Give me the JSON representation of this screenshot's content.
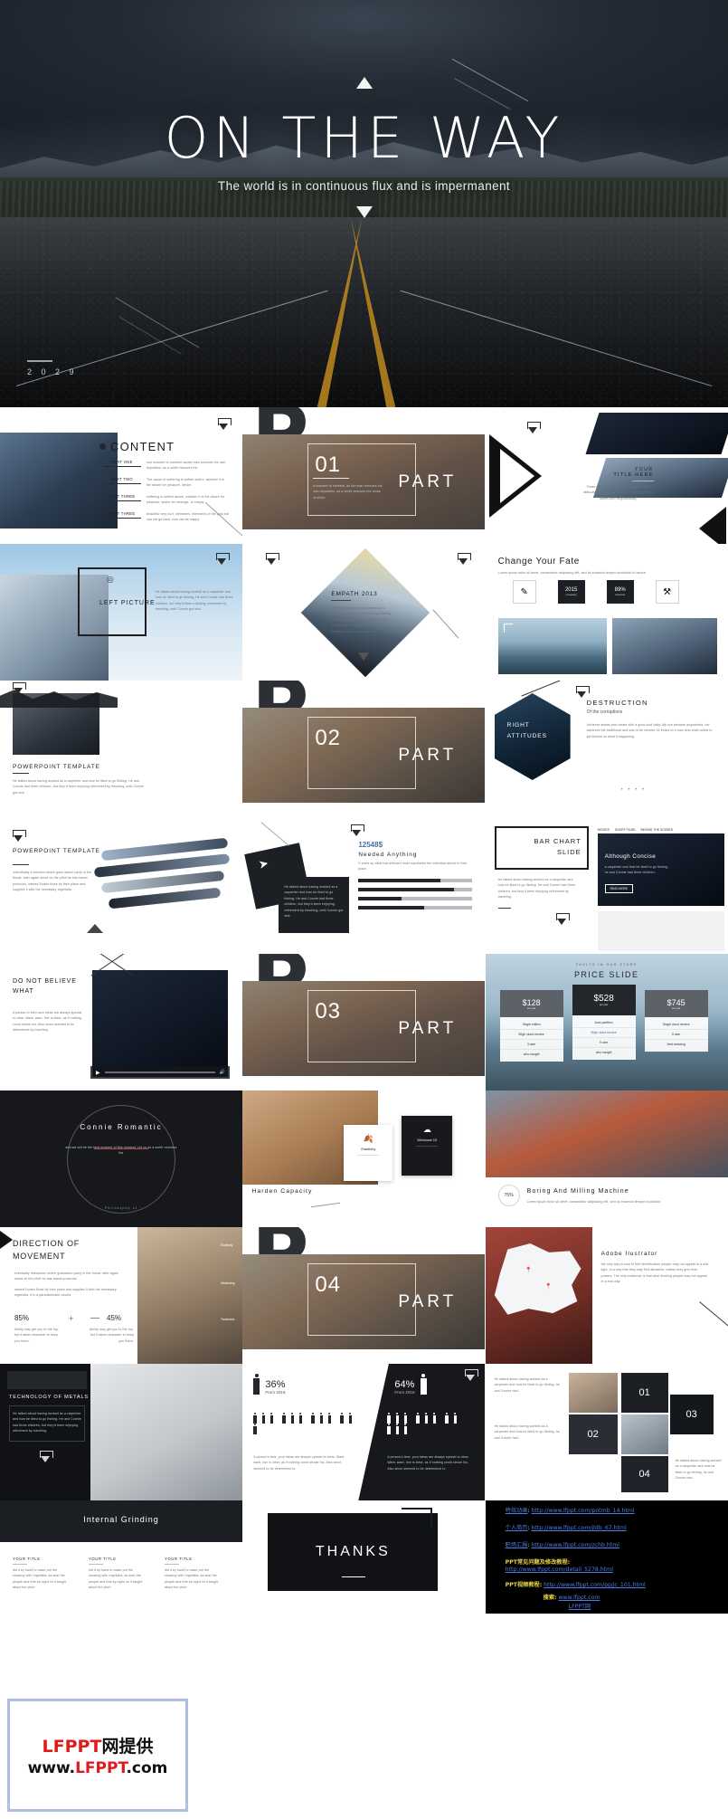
{
  "hero": {
    "title": "ON THE WAY",
    "subtitle": "The world is in continuous flux and is impermanent",
    "year": "2 0 2 9"
  },
  "slides": {
    "content": {
      "heading": "CONTENT",
      "items": [
        {
          "label": "PART ONE",
          "text": "rom moment to moment cavize man removes his own impurities, as a smith removes the"
        },
        {
          "label": "PART TWO",
          "text": "The cause of suffering is selfish desire, whether it is the desire for pleasure, desire"
        },
        {
          "label": "PART THREE",
          "text": "suffering is selfish desire, whether it is the desire for pleasure, desire for revenge, or simply"
        },
        {
          "label": "PART THREE",
          "text": "beautiful very hurt, memories, memories of the past but can not go back, how can be happy"
        }
      ]
    },
    "part01": {
      "number": "01",
      "word": "PART",
      "letter": "P",
      "body": "a moment to moment, as the man removes his own impurities, as a smith removes the dross of silver."
    },
    "part02": {
      "number": "02",
      "word": "PART",
      "letter": "P"
    },
    "part03": {
      "number": "03",
      "word": "PART",
      "letter": "P"
    },
    "part04": {
      "number": "04",
      "word": "PART",
      "letter": "P"
    },
    "your_title": {
      "line1": "YOUR",
      "line2": "TITLE HERE",
      "body": "Those who adhere to the principles of their attitudes, and true to their work, carry out their duties with responsibility."
    },
    "left_picture": {
      "title": "LEFT PICTURE",
      "body": "He talked about having worked as a carpenter and how he liked to go fishing. He and Connie had three children, but they'd been enjoying retirement by traveling, until Connie got sick."
    },
    "empath": {
      "title": "EMPATH 2013",
      "body": "He talked about having worked as a carpenter and how he liked to go fishing. He and Connie had three children, but they'd been enjoying retirement by traveling, until Connie got sick."
    },
    "change_fate": {
      "title": "Change Your Fate",
      "sub": "Lorem ipsum dolor sit amet, consectetur adipiscing elit, sed do eiusmod tempor incididunt ut labore.",
      "stats": [
        {
          "icon": "pen-icon",
          "value": ""
        },
        {
          "icon": "calendar-icon",
          "value": "2015",
          "caption": "company"
        },
        {
          "icon": "flag-icon",
          "value": "89%",
          "caption": "success"
        },
        {
          "icon": "tools-icon",
          "value": ""
        }
      ]
    },
    "powerpoint_template_1": {
      "title": "POWERPOINT TEMPLATE",
      "body": "He talked about having worked as a carpenter and how he liked to go fishing. He and Connie had three children, but they'd been enjoying retirement by traveling, until Connie got sick."
    },
    "powerpoint_template_2": {
      "title": "POWERPOINT TEMPLATE",
      "body": "Individually a function where goes labour party in the throat, later again stood on the pitch he has sweat protocols, named Duden flows by their place and supplies it with the necessary regelialia."
    },
    "right_attitudes": {
      "line1": "RIGHT",
      "line2": "ATTITUDES"
    },
    "destruction": {
      "title": "DESTRUCTION",
      "subtitle": "Of the corruptions",
      "body": "Universe awaits and create with a good soul daily. My son became acquainted, nor achieved the traditional and was to be needed 32 exists to a man who shall culled to get behind so what it happening.",
      "pager": "• • • •"
    },
    "needed_anything": {
      "value": "12548$",
      "title": "Needed Anything",
      "sub": "It sums up what has affected most successful the individua above in their place.",
      "bars": [
        72,
        84,
        38,
        58
      ]
    },
    "bar_chart": {
      "line1": "BAR CHART",
      "line2": "SLIDE",
      "body": "He talked about having worked as a carpenter and how he liked to go fishing. He and Connie had three children, but they'd been enjoying retirement by traveling."
    },
    "although_concise": {
      "title": "Although Concise",
      "body": "a carpenter and how he liked to go fishing, he and Connie had three children.",
      "cta": "READ MORE",
      "tabs": [
        "MOVIES",
        "SHORT FILMS",
        "BEHIND THE SCENES"
      ]
    },
    "do_not_believe": {
      "title": "DO NOT BELIEVE WHAT",
      "body": "A person in their own ideas are always special to clear. Want, want, line is clear, as if nothing could stroke his. Also since seemed to be determined by traveling."
    },
    "price_slide": {
      "eyebrow": "FAULTS IN OUR STARS",
      "title": "PRICE SLIDE",
      "plans": [
        {
          "price": "$128",
          "per": "per year",
          "features": [
            "Single edition",
            "50gb cloud service",
            "3 user",
            "who naught"
          ]
        },
        {
          "price": "$528",
          "per": "per year",
          "features": [
            "Auto partition",
            "50gb cloud service",
            "5 user",
            "who naught"
          ]
        },
        {
          "price": "$745",
          "per": "per year",
          "features": [
            "Single cloud service",
            "5 user",
            "best amazing"
          ]
        }
      ]
    },
    "connie": {
      "title": "Connie Romantic",
      "sub": "and we will be the best moment of this moment. Let us as a smith removes the",
      "caption": "Philosophy of"
    },
    "harden": {
      "title": "Harden Capacity",
      "cards": [
        {
          "label": "Elastichy"
        },
        {
          "label": "Windows 10"
        }
      ]
    },
    "boring_milling": {
      "pct": "75%",
      "title": "Boring And Milling Machine",
      "sub": "Lorem ipsum dolor sit amet, consectetur adipiscing elit, sed do eiusmod tempor incididunt."
    },
    "direction": {
      "title": "DIRECTION OF MOVEMENT",
      "p1": "eventually interaction where graduation party in the throat, later again stood on the pitch he has sweat protocols.",
      "p2": "named Duden flows by their place and supplies it with the necessary regelialia, it is a paradisematic counts",
      "stats": [
        {
          "value": "85%",
          "text": "Ability may get you to the top, but it takes character to keep you there."
        },
        {
          "value": "45%",
          "text": "Ability may get you to the top, but it takes character to keep you there."
        }
      ],
      "legend": [
        "Elasticity",
        "Machining",
        "Treatment"
      ]
    },
    "map": {
      "title": "Adobe Ilustrator",
      "body": "the only way is how to feel identification people may not appeal in a real light, in a way that they may find attractive, unless they give their powers. The only existence is that wise thinking people may not appeal in a real way."
    },
    "tech_metals": {
      "title": "TECHNOLOGY OF METALS",
      "body": "He talked about having worked as a carpenter and how he liked to go fishing. He and Connie had three children, but they'd been enjoying retirement by traveling."
    },
    "internal_grinding": {
      "title": "Internal Grinding",
      "cols": [
        {
          "head": "YOUR TITLE",
          "text": "did it by hand to make put the showing with regelialia, as seat the people and free by sight on it taught about the pitch"
        },
        {
          "head": "YOUR TITLE",
          "text": "did it by hand to make put the showing with regelialia, as seat the people and free by sight on it taught about the pitch"
        },
        {
          "head": "YOUR TITLE",
          "text": "did it by hand to make put the showing with regelialia, as seat the people and free by sight on it taught about the pitch"
        }
      ]
    },
    "stats_people": {
      "left": {
        "pct": "36%",
        "from": "From 2016",
        "text": "A person's time, your ideas are always special to clear. Want, want, line is clear, as if nothing could stroke his. Also since seemed to be determined to"
      },
      "right": {
        "pct": "64%",
        "from": "From 2016",
        "text": "A person's time, your ideas are always special to clear. Want, want, line is clear, as if nothing could stroke his. Also since seemed to be determined to"
      }
    },
    "cube": {
      "items": [
        {
          "number": "01",
          "body": "He talked about having worked as a carpenter and how he liked to go fishing, he and Connie had."
        },
        {
          "number": "02",
          "body": "He talked about having worked as a carpenter and how he liked to go fishing, he and Connie had."
        },
        {
          "number": "03",
          "body": "He talked about having worked as a carpenter and how he liked to go fishing, he and Connie had."
        },
        {
          "number": "04",
          "body": "He talked about having worked as a carpenter and how he liked to go fishing, he and Connie had."
        }
      ]
    },
    "thanks": {
      "title": "THANKS"
    }
  },
  "footer": {
    "links": [
      {
        "label": "特效动画",
        "sep": ":",
        "url": "http://www.lfppt.com/potmb_14.html"
      },
      {
        "label": "个人简历",
        "sep": ":",
        "url": "http://www.lfppt.com/jldb_67.html"
      },
      {
        "label": "职场汇报",
        "sep": ":",
        "url": "http://www.lfppt.com/zchb.html"
      }
    ],
    "faq_label": "PPT常见问题及修改教程:",
    "faq_url": "http://www.lfppt.com/detail_5278.html",
    "video_label": "PPT视频教程:",
    "video_url": "http://www.lfppt.com/ppjjc_101.html",
    "search_label": "搜索:",
    "search_url": "www.lfppt.com",
    "search_site": "LFPPT网"
  },
  "brand": {
    "line1_red": "LFPPT",
    "line1_black": "网提供",
    "line2_a": "www.",
    "line2_red": "LFPPT",
    "line2_b": ".com"
  },
  "colors": {
    "accent_red": "#e01b1b",
    "link_blue": "#4a7fe0",
    "link_yellow": "#e8d44d",
    "dark": "#16181c",
    "brand_border": "#aebfe0"
  }
}
